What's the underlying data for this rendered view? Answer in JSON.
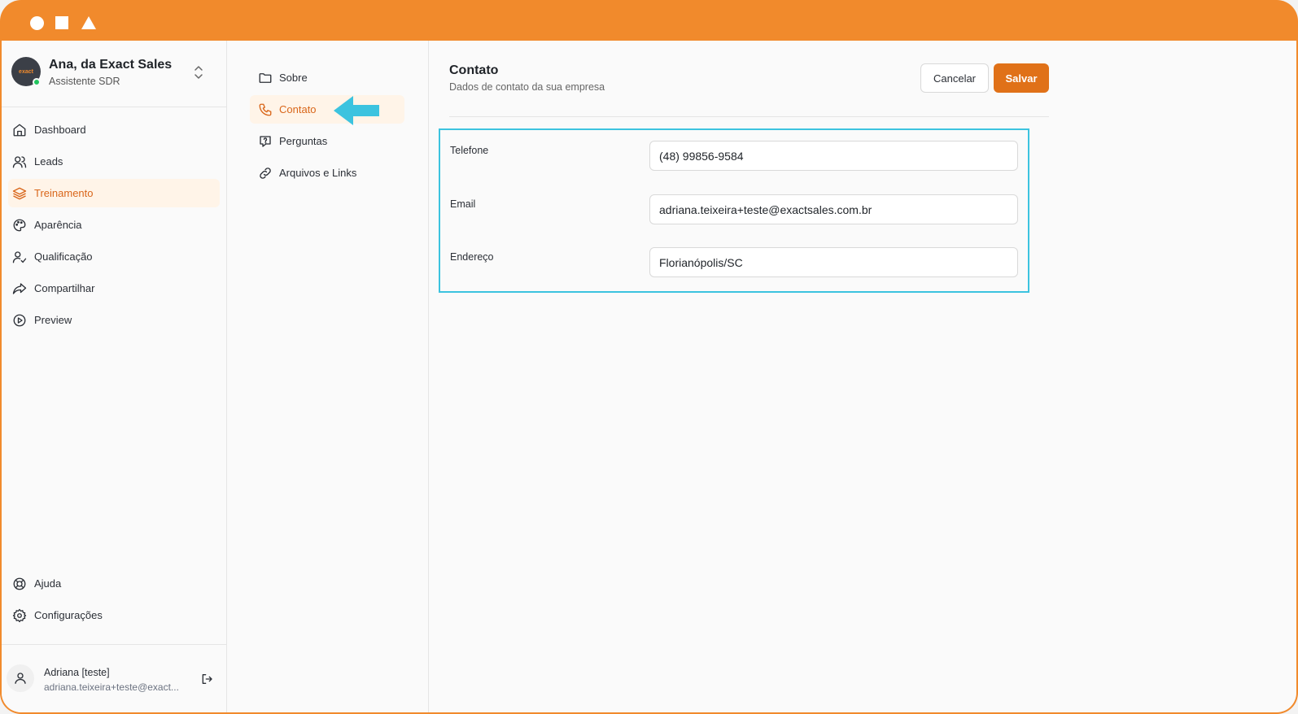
{
  "window": {
    "controls": [
      "circle",
      "square",
      "triangle"
    ]
  },
  "profile": {
    "name": "Ana, da Exact Sales",
    "role": "Assistente SDR",
    "avatar_text": "exact",
    "status_color": "#22c55e"
  },
  "sidebar": {
    "items": [
      {
        "label": "Dashboard",
        "icon": "home-icon"
      },
      {
        "label": "Leads",
        "icon": "users-icon"
      },
      {
        "label": "Treinamento",
        "icon": "layers-icon",
        "active": true
      },
      {
        "label": "Aparência",
        "icon": "palette-icon"
      },
      {
        "label": "Qualificação",
        "icon": "user-check-icon"
      },
      {
        "label": "Compartilhar",
        "icon": "share-icon"
      },
      {
        "label": "Preview",
        "icon": "play-circle-icon"
      }
    ],
    "bottom_items": [
      {
        "label": "Ajuda",
        "icon": "lifebuoy-icon"
      },
      {
        "label": "Configurações",
        "icon": "settings-icon"
      }
    ]
  },
  "user": {
    "name": "Adriana [teste]",
    "email": "adriana.teixeira+teste@exact..."
  },
  "subnav": {
    "items": [
      {
        "label": "Sobre",
        "icon": "folder-icon"
      },
      {
        "label": "Contato",
        "icon": "phone-icon",
        "active": true
      },
      {
        "label": "Perguntas",
        "icon": "message-question-icon"
      },
      {
        "label": "Arquivos e Links",
        "icon": "link-icon"
      }
    ]
  },
  "main": {
    "title": "Contato",
    "subtitle": "Dados de contato da sua empresa",
    "cancel_label": "Cancelar",
    "save_label": "Salvar",
    "fields": [
      {
        "label": "Telefone",
        "value": "(48) 99856-9584"
      },
      {
        "label": "Email",
        "value": "adriana.teixeira+teste@exactsales.com.br"
      },
      {
        "label": "Endereço",
        "value": "Florianópolis/SC"
      }
    ]
  },
  "colors": {
    "brand": "#f18a2c",
    "accent": "#e07118",
    "active_bg": "#fff4e8",
    "highlight": "#3cc3df"
  }
}
